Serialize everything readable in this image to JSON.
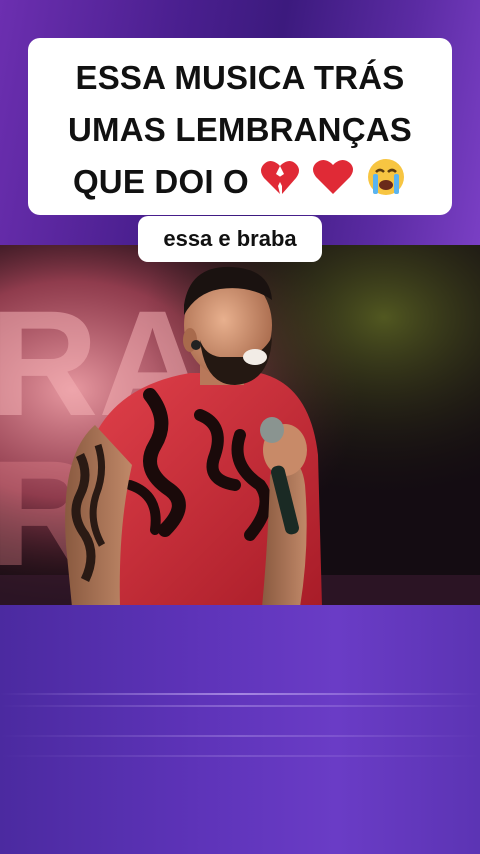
{
  "caption": {
    "line1": "ESSA MUSICA TRÁS",
    "line2": "UMAS LEMBRANÇAS",
    "line3": "QUE DOI O",
    "emojis": [
      "broken-heart-icon",
      "red-heart-icon",
      "crying-face-icon"
    ]
  },
  "subtitle": "essa e braba",
  "colors": {
    "accent_purple": "#5a2a9a",
    "shirt_red": "#c8262e",
    "caption_bg": "#ffffff"
  }
}
